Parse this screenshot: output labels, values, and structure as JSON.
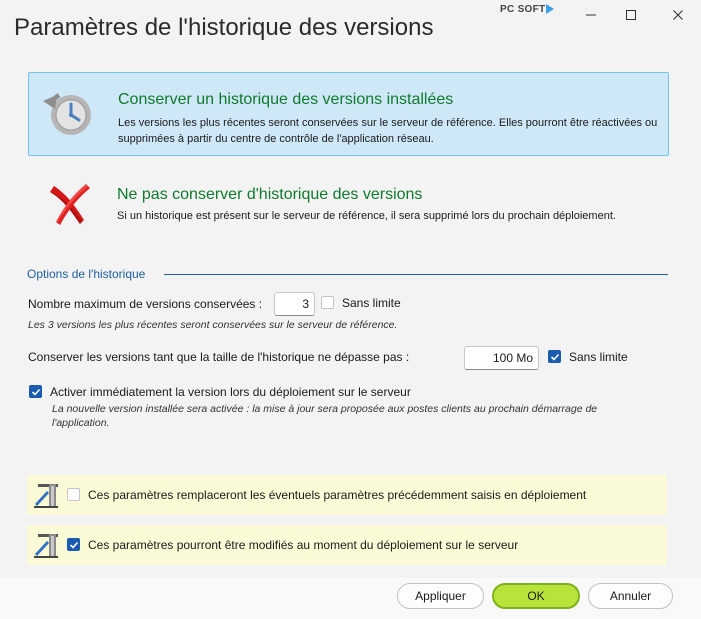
{
  "window": {
    "title": "Paramètres de l'historique des versions",
    "brand": "PC SOFT",
    "minimize_glyph": "—",
    "maximize_glyph": "☐",
    "close_glyph": "✕"
  },
  "options": {
    "keep": {
      "title": "Conserver un historique des versions installées",
      "description": "Les versions les plus récentes seront conservées sur le serveur de référence. Elles pourront être réactivées ou supprimées à partir du centre de contrôle de l'application réseau.",
      "icon": "history-clock-icon",
      "selected": true
    },
    "no_keep": {
      "title": "Ne pas conserver d'historique des versions",
      "description": "Si un historique est présent sur le serveur de référence, il sera supprimé lors du prochain déploiement.",
      "icon": "red-cross-icon",
      "selected": false
    }
  },
  "history_options": {
    "group_title": "Options de l'historique",
    "max_versions": {
      "label": "Nombre maximum de versions conservées :",
      "value": "3",
      "no_limit_label": "Sans limite",
      "no_limit_checked": false,
      "hint": "Les 3 versions les plus récentes seront conservées sur le serveur de référence."
    },
    "max_size": {
      "label": "Conserver les versions tant que la taille de l'historique ne dépasse pas :",
      "value": "100 Mo",
      "no_limit_label": "Sans limite",
      "no_limit_checked": true
    },
    "activate": {
      "label": "Activer immédiatement la version lors du déploiement sur le serveur",
      "checked": true,
      "hint_line1": "La nouvelle version installée sera activée : la mise à jour sera proposée aux postes clients au prochain démarrage de",
      "hint_line2": "l'application."
    }
  },
  "deployment": {
    "replace": {
      "label": "Ces paramètres remplaceront les éventuels paramètres précédemment saisis en déploiement",
      "checked": false
    },
    "modifiable": {
      "label": "Ces paramètres pourront être modifiés au moment du déploiement sur le serveur",
      "checked": true
    }
  },
  "buttons": {
    "apply": "Appliquer",
    "ok": "OK",
    "cancel": "Annuler"
  },
  "colors": {
    "accent_green": "#107a2e",
    "selected_card_bg": "#cfe8f8",
    "selected_card_border": "#72c2ea",
    "group_blue": "#1f5fa0",
    "checkbox_blue": "#1b5bb0",
    "ok_green": "#b8e33a",
    "panel_yellow": "#fbfad6"
  }
}
